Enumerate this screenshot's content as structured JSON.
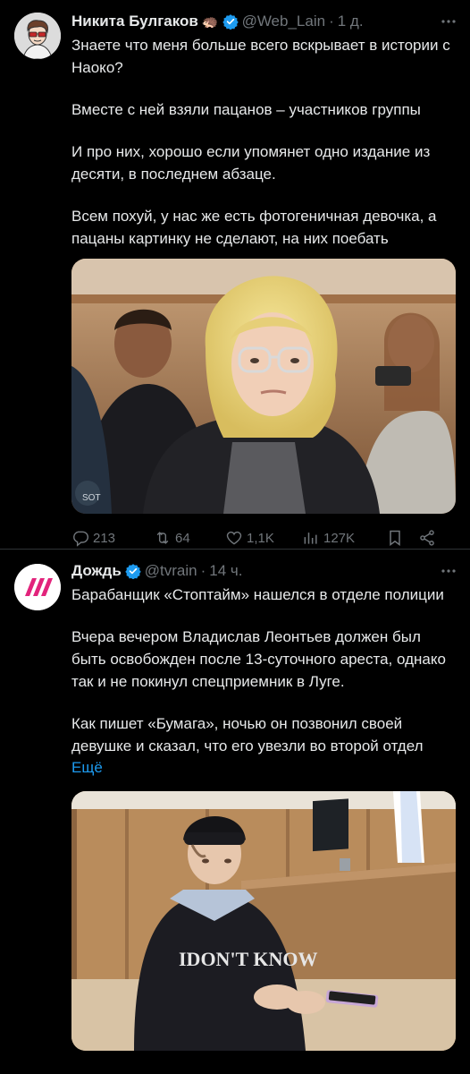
{
  "tweets": [
    {
      "author_name": "Никита Булгаков",
      "author_emoji": "🦔",
      "handle": "@Web_Lain",
      "separator": "·",
      "time": "1 д.",
      "paragraphs": [
        "Знаете что меня больше всего вскрывает в истории с Наоко?",
        "Вместе с ней взяли пацанов – участников группы",
        "И про них, хорошо если упомянет одно издание из десяти, в последнем абзаце.",
        "Всем похуй, у нас же есть фотогеничная девочка, а пацаны картинку не сделают, на них поебать"
      ],
      "stats": {
        "replies": "213",
        "retweets": "64",
        "likes": "1,1K",
        "views": "127K"
      }
    },
    {
      "author_name": "Дождь",
      "handle": "@tvrain",
      "separator": "·",
      "time": "14 ч.",
      "paragraphs": [
        "Барабанщик «Стоптайм» нашелся в отделе полиции",
        "Вчера вечером Владислав Леонтьев должен был быть освобожден после 13-суточного ареста, однако так и не покинул спецприемник в Луге.",
        "Как пишет «Бумага», ночью он позвонил своей девушке и сказал, что его увезли во второй отдел"
      ],
      "show_more": "Ещё",
      "media_text": "IDON'T KNOW"
    }
  ],
  "colors": {
    "background": "#000000",
    "text": "#e7e9ea",
    "muted": "#71767b",
    "accent": "#1d9bf0",
    "verified": "#1d9bf0",
    "dozhd_brand": "#e2247c"
  },
  "icons": [
    "more-icon",
    "verified-icon",
    "reply-icon",
    "retweet-icon",
    "like-icon",
    "views-icon",
    "bookmark-icon",
    "share-icon"
  ]
}
